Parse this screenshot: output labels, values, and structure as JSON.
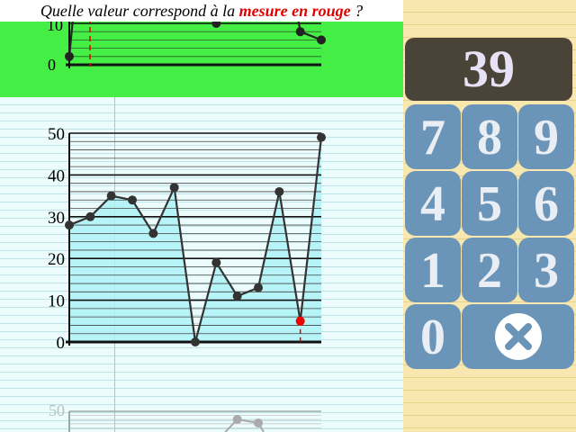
{
  "question": {
    "prefix": "Quelle valeur correspond à la ",
    "highlight": "mesure en rouge",
    "suffix": " ?"
  },
  "display": {
    "value": "39"
  },
  "keypad": {
    "keys": [
      "7",
      "8",
      "9",
      "4",
      "5",
      "6",
      "1",
      "2",
      "3",
      "0"
    ],
    "clear_icon": "clear-x-icon"
  },
  "colors": {
    "previous_panel": "#44ee44",
    "chart_fill": "#aef2f6",
    "highlight_point": "#ee0000",
    "key_bg": "#6b95b8",
    "display_bg": "#4a4338"
  },
  "chart_data": [
    {
      "type": "line",
      "role": "previous-chart-partial",
      "y_ticks": [
        "0",
        "10"
      ],
      "ylim": [
        0,
        50
      ],
      "x": [
        1,
        2,
        3,
        4,
        5,
        6,
        7,
        8,
        9,
        10,
        11,
        12,
        13
      ],
      "values": [
        null,
        null,
        null,
        null,
        null,
        null,
        null,
        null,
        null,
        null,
        null,
        null,
        8,
        6
      ],
      "visible_points": [
        [
          0,
          2
        ],
        [
          7,
          10
        ],
        [
          11,
          8
        ],
        [
          12,
          6
        ]
      ]
    },
    {
      "type": "line",
      "role": "current-chart",
      "title": "",
      "xlabel": "",
      "ylabel": "",
      "ylim": [
        0,
        50
      ],
      "y_ticks": [
        "0",
        "10",
        "20",
        "30",
        "40",
        "50"
      ],
      "grid": true,
      "values": [
        28,
        30,
        35,
        34,
        26,
        37,
        0,
        19,
        11,
        13,
        36,
        5,
        49
      ],
      "highlight_index": 11
    },
    {
      "type": "line",
      "role": "next-chart-partial",
      "y_ticks": [
        "50"
      ],
      "ylim": [
        0,
        50
      ],
      "visible_points": [
        [
          8,
          48
        ],
        [
          9,
          47
        ]
      ]
    }
  ]
}
